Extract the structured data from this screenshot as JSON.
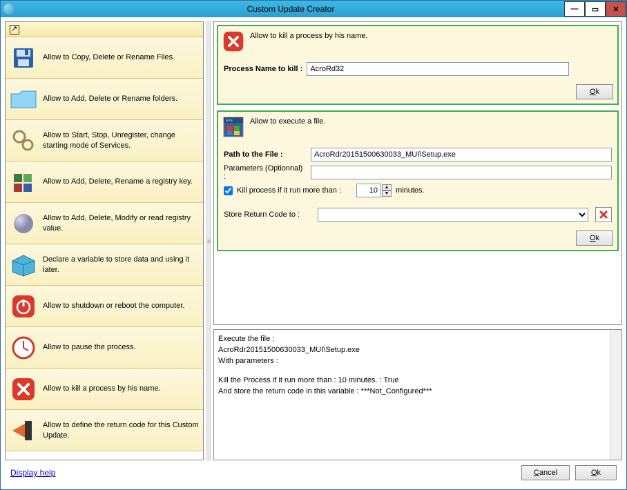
{
  "window": {
    "title": "Custom Update Creator"
  },
  "sidebar": {
    "items": [
      {
        "label": "Allow to Copy, Delete or Rename Files."
      },
      {
        "label": "Allow to Add, Delete or Rename folders."
      },
      {
        "label": "Allow to Start, Stop, Unregister, change starting mode of Services."
      },
      {
        "label": "Allow to Add, Delete, Rename a registry key."
      },
      {
        "label": "Allow to Add, Delete, Modify or read registry value."
      },
      {
        "label": "Declare a variable to store data and using it later."
      },
      {
        "label": "Allow to shutdown or reboot the computer."
      },
      {
        "label": "Allow to pause the process."
      },
      {
        "label": "Allow to kill a process by his name."
      },
      {
        "label": "Allow to define the return code for this Custom Update."
      }
    ]
  },
  "kill_card": {
    "desc": "Allow to kill a process by his name.",
    "label": "Process Name to kill :",
    "value": "AcroRd32",
    "ok": "Ok"
  },
  "exec_card": {
    "desc": "Allow to execute a file.",
    "path_lbl": "Path to the File :",
    "path_val": "AcroRdr20151500630033_MUI\\Setup.exe",
    "params_lbl": "Parameters (Optionnal) :",
    "params_val": "",
    "kill_chk_lbl": "Kill process if it run more than :",
    "kill_min_val": "10",
    "kill_min_suffix": "minutes.",
    "store_lbl": "Store Return Code to :",
    "store_val": "",
    "ok": "Ok"
  },
  "log": {
    "l1": "Execute the file :",
    "l2": "AcroRdr20151500630033_MUI\\Setup.exe",
    "l3": "With parameters :",
    "l4": "Kill the Process if it run more than : 10 minutes. : True",
    "l5": "And store the return code in this variable : ***Not_Configured***"
  },
  "footer": {
    "help": "Display help",
    "cancel": "Cancel",
    "ok": "Ok"
  }
}
